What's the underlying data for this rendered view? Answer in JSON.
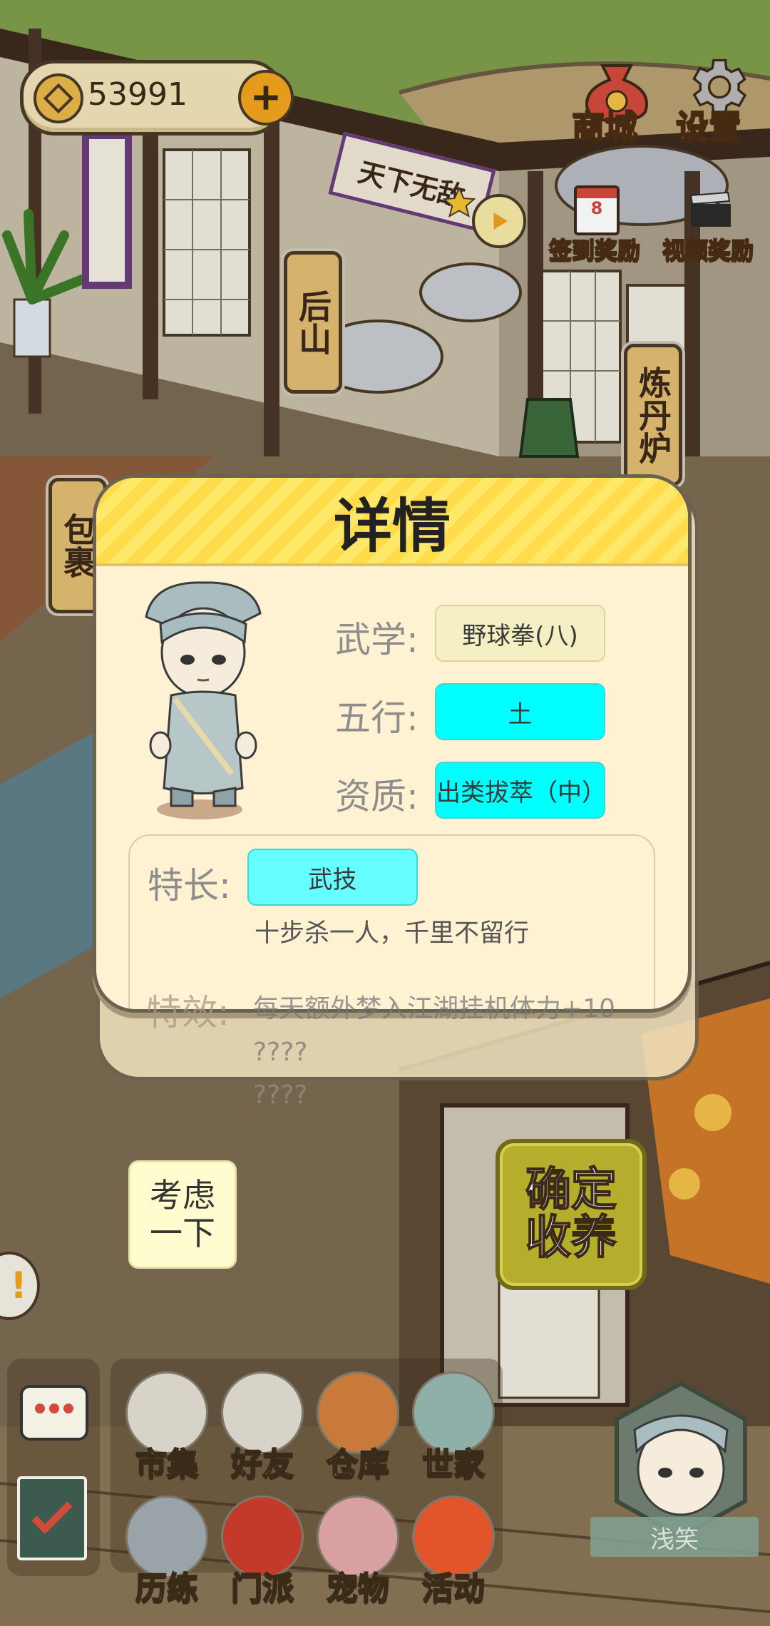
{
  "hud": {
    "coins": "53991"
  },
  "top_right": {
    "shop": "商城",
    "settings": "设置",
    "checkin_reward": "签到奖励",
    "video_reward": "视频奖励",
    "calendar_day": "8"
  },
  "buildings": {
    "sign_top": "天下无敌",
    "houshan": "后山",
    "liandanlu": "炼丹炉",
    "baoguo": "包裹"
  },
  "dialog": {
    "title": "详情",
    "martial_label": "武学:",
    "martial_value": "野球拳(八)",
    "element_label": "五行:",
    "element_value": "土",
    "aptitude_label": "资质:",
    "aptitude_value": "出类拔萃（中）",
    "specialty_label": "特长:",
    "specialty_value": "武技",
    "specialty_desc": "十步杀一人，千里不留行",
    "effect_label": "特效:",
    "effect_text": "每天额外梦入江湖挂机体力+10",
    "effect_hidden_1": "????",
    "effect_hidden_2": "????"
  },
  "buttons": {
    "consider": "考虑\n一下",
    "confirm": "确定\n收养"
  },
  "bottom_nav": {
    "row1": [
      "市集",
      "好友",
      "仓库",
      "世家"
    ],
    "row2": [
      "历练",
      "门派",
      "宠物",
      "活动"
    ]
  },
  "avatar": {
    "mood": "浅笑"
  },
  "colors": {
    "cyan": "#00ffff",
    "light_cyan": "#66ffff",
    "dialog_bg": "#fff2d3",
    "title_yellow": "#ffe76a",
    "confirm_green": "#b5ad2c"
  }
}
